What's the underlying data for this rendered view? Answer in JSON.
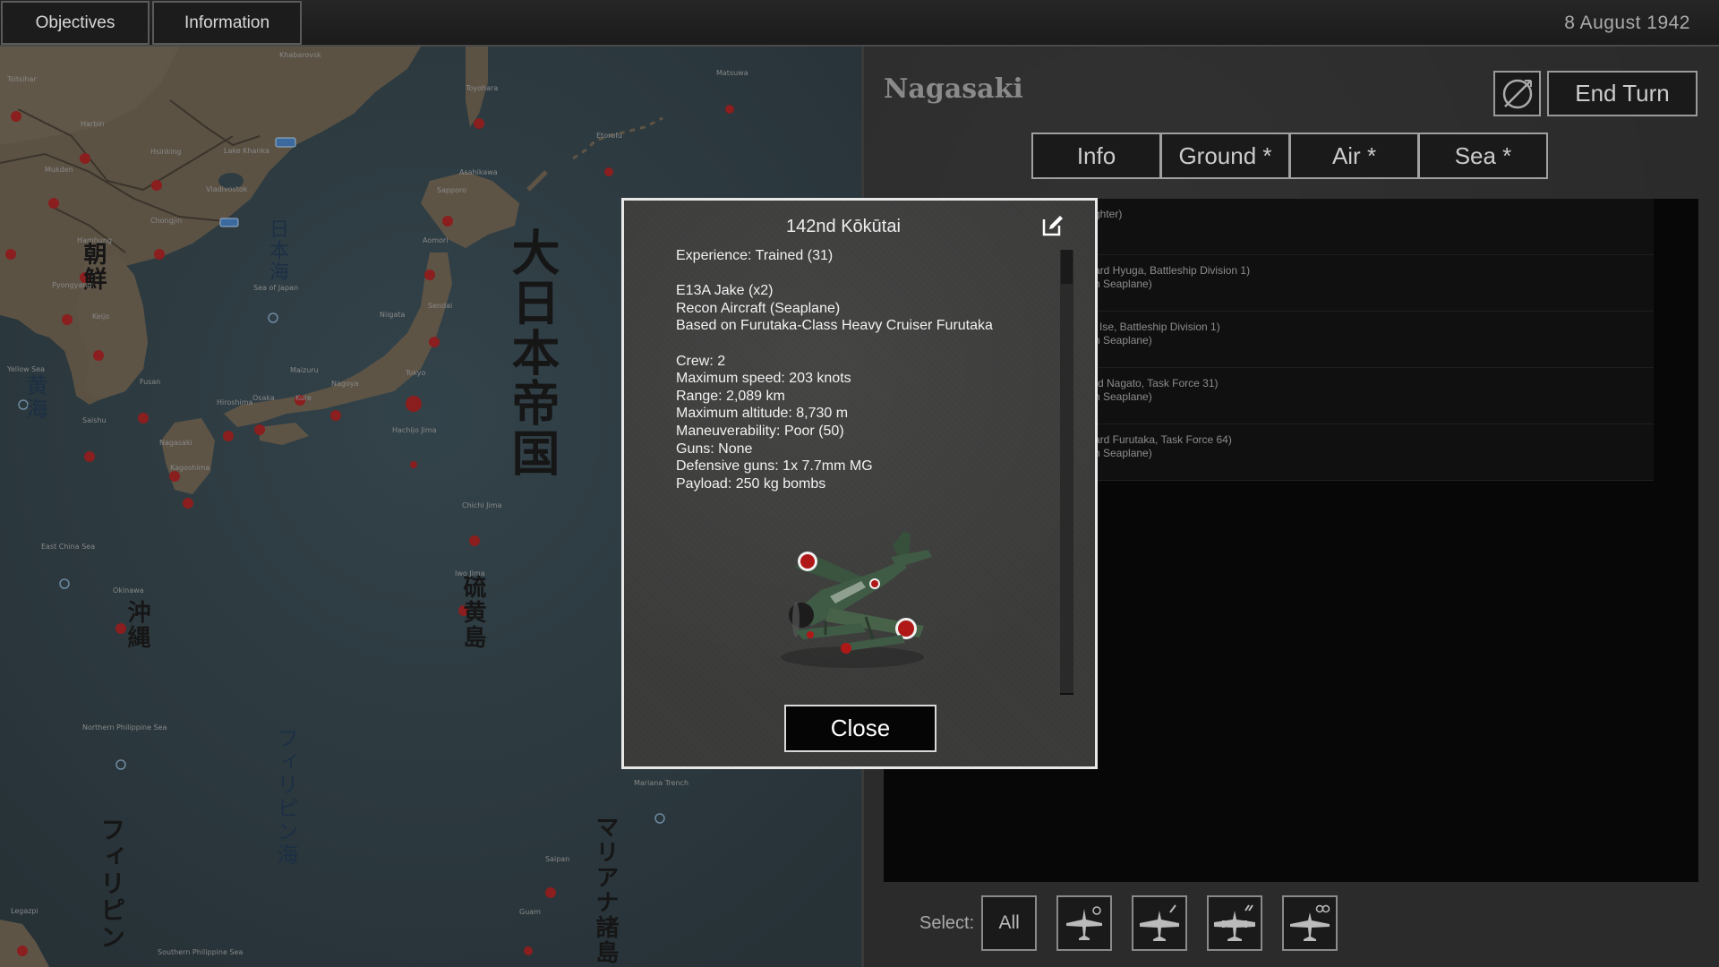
{
  "topbar": {
    "objectives_label": "Objectives",
    "information_label": "Information",
    "date": "8 August 1942"
  },
  "map": {
    "large_labels": {
      "empire": "大日本帝国",
      "korea": "朝鮮",
      "sea_of_japan": "日本海",
      "yellow_sea": "黄海",
      "okinawa": "沖縄",
      "iwo_jima": "硫黄島",
      "philippine_sea": "フィリピン海",
      "marianas": "マリアナ諸島",
      "philippines": "フィリピン"
    },
    "places": [
      "Tsitsihar",
      "Khabarovsk",
      "Harbin",
      "Hsinking",
      "Mukden",
      "Lake Khanka",
      "Vladivostok",
      "Chongjin",
      "Hamhung",
      "Pyongyang",
      "Keijo",
      "Fusan",
      "Saishu",
      "Sea of Japan",
      "Yellow Sea",
      "Nagasaki",
      "Kagoshima",
      "Hiroshima",
      "Osaka",
      "Kure",
      "Maizuru",
      "Nagoya",
      "Tokyo",
      "Niigata",
      "Sendai",
      "Aomori",
      "Sapporo",
      "Asahikawa",
      "Etorofu",
      "Matsuwa",
      "Toyohara",
      "Hachijo Jima",
      "Chichi Jima",
      "Iwo Jima",
      "Okinawa",
      "East China Sea",
      "Northern Philippine Sea",
      "Mariana Trench",
      "Saipan",
      "Guam",
      "Legazpi",
      "Southern Philippine Sea"
    ],
    "colors": {
      "sea": "#2d3a3e",
      "land": "#5e5446",
      "land_dark": "#4a4238",
      "base_marker": "#8b1e1e"
    }
  },
  "panel": {
    "title": "Nagasaki",
    "end_turn_label": "End Turn",
    "settings_icon": "no-symbol-icon",
    "tabs": [
      {
        "label": "Info"
      },
      {
        "label": "Ground *"
      },
      {
        "label": "Air *"
      },
      {
        "label": "Sea *"
      }
    ],
    "list_rows": [
      {
        "line1": "ghter)",
        "line2": ""
      },
      {
        "line1": "ard Hyuga, Battleship Division 1)",
        "line2": "n Seaplane)"
      },
      {
        "line1": "l Ise, Battleship Division 1)",
        "line2": "n Seaplane)"
      },
      {
        "line1": "rd Nagato, Task Force 31)",
        "line2": "n Seaplane)"
      },
      {
        "line1": "ard Furutaka, Task Force 64)",
        "line2": "n Seaplane)"
      }
    ],
    "select": {
      "label": "Select:",
      "all_label": "All",
      "filters": [
        "fighter-filter-icon",
        "bomber-filter-icon",
        "heavy-bomber-filter-icon",
        "recon-filter-icon"
      ]
    }
  },
  "dialog": {
    "title": "142nd Kōkūtai",
    "edit_icon": "edit-icon",
    "experience": "Experience: Trained (31)",
    "aircraft": "E13A Jake (x2)",
    "role": "Recon Aircraft (Seaplane)",
    "base": "Based on Furutaka-Class Heavy Cruiser Furutaka",
    "crew": "Crew: 2",
    "max_speed": "Maximum speed: 203 knots",
    "range": "Range: 2,089 km",
    "max_altitude": "Maximum altitude: 8,730 m",
    "maneuverability": "Maneuverability: Poor (50)",
    "guns": "Guns: None",
    "defensive_guns": "Defensive guns: 1x 7.7mm MG",
    "payload": "Payload: 250 kg bombs",
    "close_label": "Close",
    "colors": {
      "aircraft_body": "#3f5a45",
      "hinomaru": "#b01818"
    }
  }
}
